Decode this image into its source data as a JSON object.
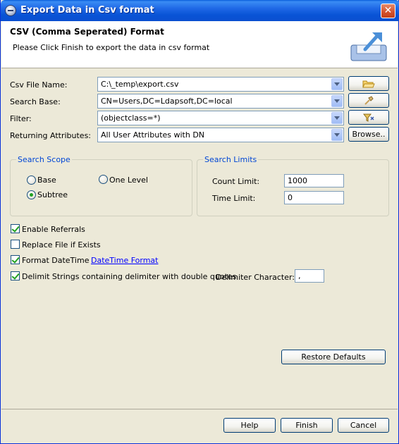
{
  "window": {
    "title": "Export Data in Csv format",
    "close": "✕"
  },
  "header": {
    "title": "CSV (Comma Seperated) Format",
    "description": "Please Click Finish to export the data in csv format",
    "icon": "export-icon"
  },
  "form": {
    "csv_file_label": "Csv File Name:",
    "csv_file_value": "C:\\_temp\\export.csv",
    "search_base_label": "Search Base:",
    "search_base_value": "CN=Users,DC=Ldapsoft,DC=local",
    "filter_label": "Filter:",
    "filter_value": "(objectclass=*)",
    "attributes_label": "Returning Attributes:",
    "attributes_value": "All User Attributes with DN",
    "browse_label": "Browse.."
  },
  "scope": {
    "title": "Search Scope",
    "base": "Base",
    "one_level": "One Level",
    "subtree": "Subtree",
    "selected": "Subtree"
  },
  "limits": {
    "title": "Search Limits",
    "count_label": "Count Limit:",
    "count_value": "1000",
    "time_label": "Time Limit:",
    "time_value": "0"
  },
  "options": {
    "enable_referrals": {
      "label": "Enable Referrals",
      "checked": true
    },
    "replace_file": {
      "label": "Replace File if Exists",
      "checked": false
    },
    "format_datetime": {
      "label": "Format DateTime",
      "checked": true,
      "link": "DateTime Format"
    },
    "delimit_strings": {
      "label": "Delimit Strings containing delimiter with double quotes",
      "checked": true
    },
    "delimiter_label": "Delimiter Character:",
    "delimiter_value": ","
  },
  "buttons": {
    "restore_defaults": "Restore Defaults",
    "help": "Help",
    "finish": "Finish",
    "cancel": "Cancel"
  },
  "colors": {
    "title_bar": "#0a55d8",
    "group_title": "#0046d5",
    "link": "#0000ff"
  }
}
